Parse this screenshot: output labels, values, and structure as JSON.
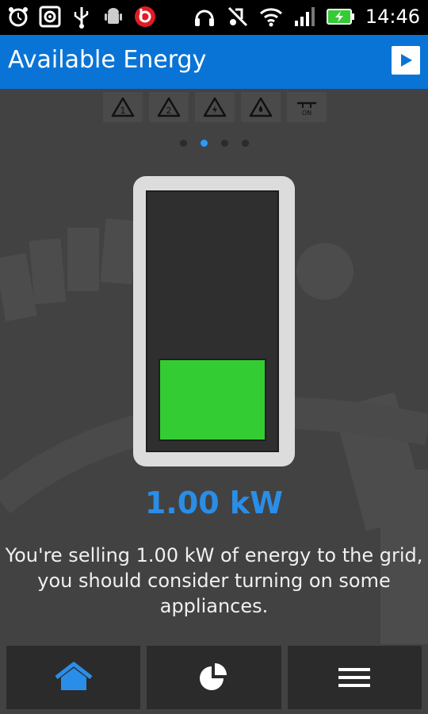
{
  "status_bar": {
    "time": "14:46",
    "icons": [
      "alarm-icon",
      "media-icon",
      "usb-icon",
      "android-debug-icon",
      "beats-icon",
      "headphones-icon",
      "mute-icon",
      "wifi-icon",
      "signal-icon",
      "battery-charging-icon"
    ]
  },
  "action_bar": {
    "title": "Available Energy",
    "play_icon": "play-icon"
  },
  "tabs": [
    {
      "label": "1",
      "icon": "warning-1-icon"
    },
    {
      "label": "2",
      "icon": "warning-2-icon"
    },
    {
      "label": "",
      "icon": "warning-lightning-icon"
    },
    {
      "label": "",
      "icon": "warning-drop-icon"
    },
    {
      "label": "ON",
      "icon": "switch-on-icon"
    }
  ],
  "pager": {
    "count": 4,
    "active": 1
  },
  "battery": {
    "fill_fraction": 0.32,
    "fill_color": "#33cc33"
  },
  "main": {
    "value": "1.00 kW",
    "message_lines": [
      "You're selling 1.00 kW of energy to the grid,",
      "you should consider turning on some",
      "appliances."
    ]
  },
  "bottom_nav": [
    {
      "icon": "home-icon",
      "active": true
    },
    {
      "icon": "pie-chart-icon",
      "active": false
    },
    {
      "icon": "menu-icon",
      "active": false
    }
  ],
  "colors": {
    "accent": "#0a74d6",
    "value_text": "#2a8ee8",
    "fill": "#33cc33"
  }
}
